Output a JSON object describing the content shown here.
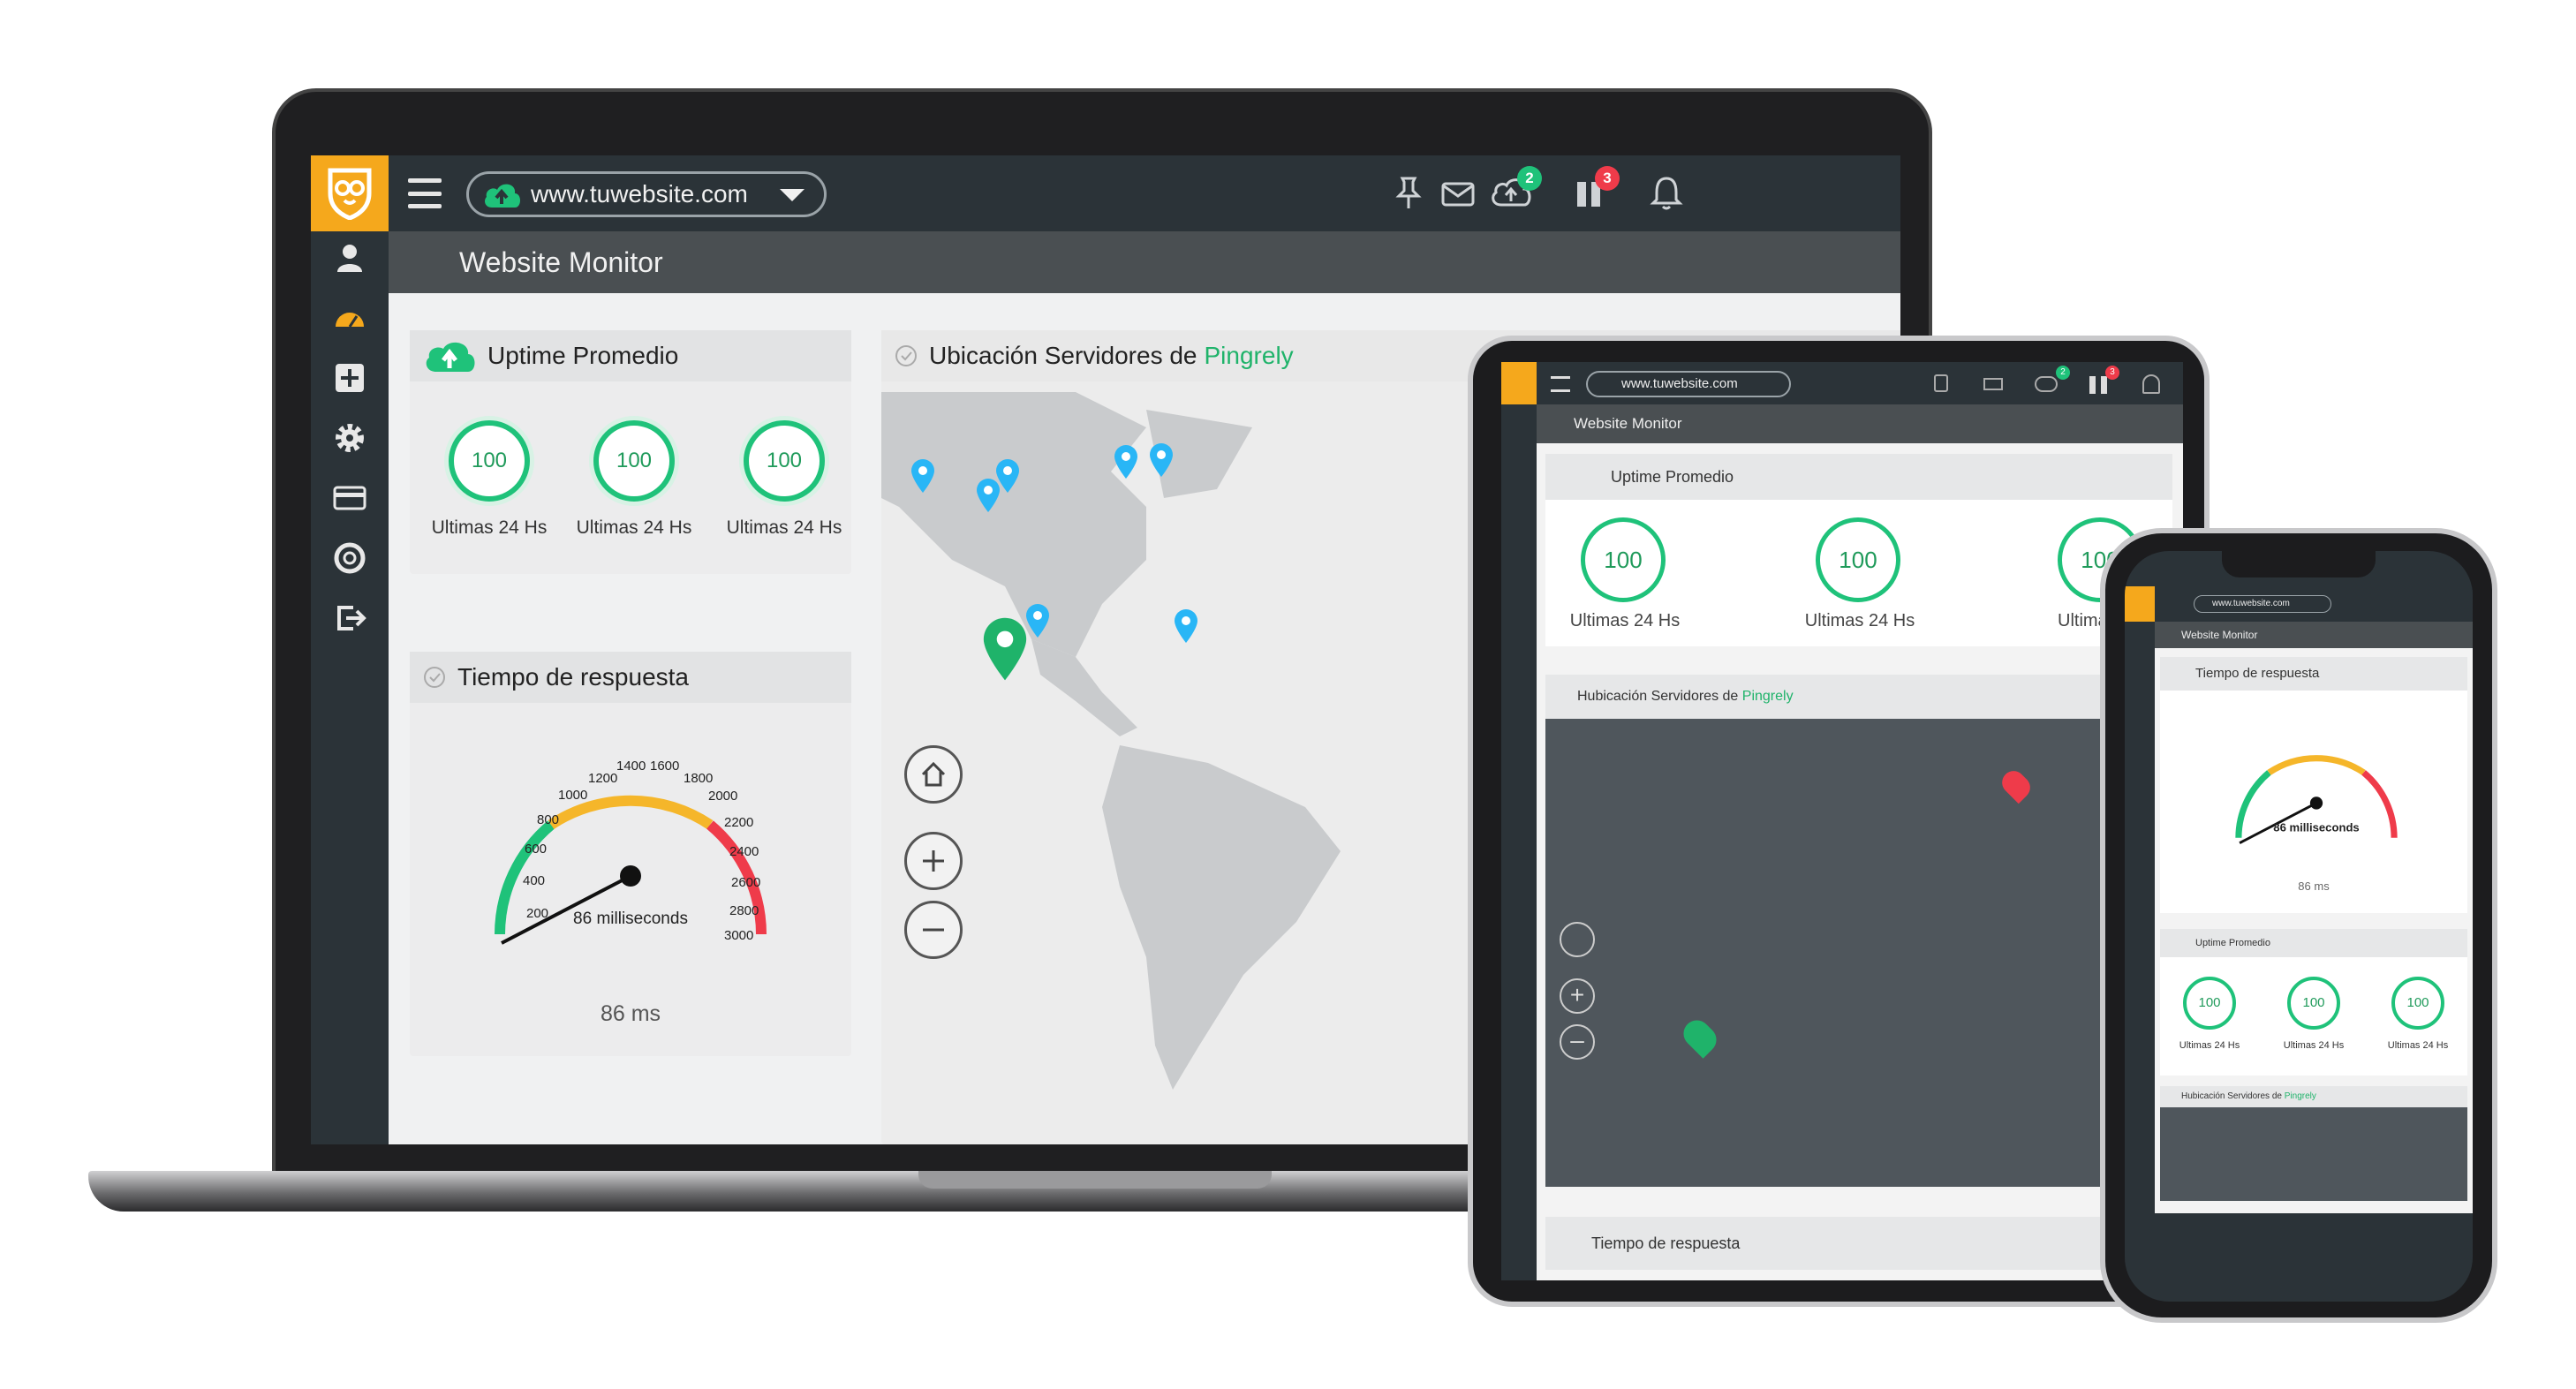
{
  "brand": {
    "accent": "#f5a81c",
    "success": "#1fc27a",
    "danger": "#ef3b4a",
    "pin": "#29b6f6",
    "dark": "#2b3338"
  },
  "topbar": {
    "site_select": "www.tuwebsite.com",
    "icons": [
      "pin-icon",
      "mail-icon",
      "cloud-upload-icon",
      "pause-icon",
      "bell-icon"
    ],
    "upload_badge": "2",
    "pause_badge": "3"
  },
  "sidebar": {
    "icons": [
      "user-icon",
      "dashboard-icon",
      "add-icon",
      "gear-icon",
      "card-icon",
      "lifebuoy-icon",
      "logout-icon"
    ]
  },
  "page": {
    "title": "Website Monitor"
  },
  "uptime": {
    "title": "Uptime Promedio",
    "items": [
      {
        "value": "100",
        "label": "Ultimas 24 Hs"
      },
      {
        "value": "100",
        "label": "Ultimas 24 Hs"
      },
      {
        "value": "100",
        "label": "Ultimas 24 Hs"
      }
    ]
  },
  "response": {
    "title": "Tiempo de respuesta",
    "gauge_ticks": [
      "200",
      "400",
      "600",
      "800",
      "1000",
      "1200",
      "1400",
      "1600",
      "1800",
      "2000",
      "2200",
      "2400",
      "2600",
      "2800",
      "3000"
    ],
    "value_ms": 86,
    "gauge_label": "86 milliseconds",
    "value_text": "86 ms"
  },
  "map_laptop": {
    "title": "Ubicación Servidores de",
    "highlight": "Pingrely"
  },
  "map_tablet": {
    "title": "Hubicación Servidores de",
    "highlight": "Pingrely"
  },
  "tablet": {
    "uptime_labels": [
      "Ultimas 24 Hs",
      "Ultimas 24 Hs",
      "Ultimas"
    ]
  }
}
